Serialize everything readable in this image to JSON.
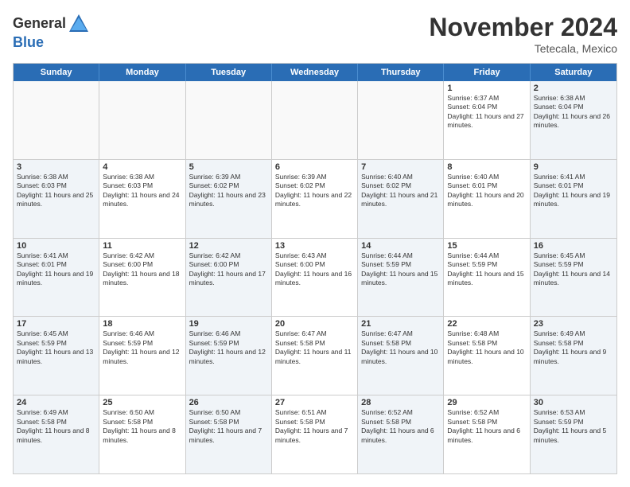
{
  "logo": {
    "line1": "General",
    "line2": "Blue"
  },
  "title": "November 2024",
  "subtitle": "Tetecala, Mexico",
  "header_days": [
    "Sunday",
    "Monday",
    "Tuesday",
    "Wednesday",
    "Thursday",
    "Friday",
    "Saturday"
  ],
  "weeks": [
    [
      {
        "day": "",
        "info": "",
        "empty": true
      },
      {
        "day": "",
        "info": "",
        "empty": true
      },
      {
        "day": "",
        "info": "",
        "empty": true
      },
      {
        "day": "",
        "info": "",
        "empty": true
      },
      {
        "day": "",
        "info": "",
        "empty": true
      },
      {
        "day": "1",
        "info": "Sunrise: 6:37 AM\nSunset: 6:04 PM\nDaylight: 11 hours and 27 minutes.",
        "empty": false
      },
      {
        "day": "2",
        "info": "Sunrise: 6:38 AM\nSunset: 6:04 PM\nDaylight: 11 hours and 26 minutes.",
        "empty": false
      }
    ],
    [
      {
        "day": "3",
        "info": "Sunrise: 6:38 AM\nSunset: 6:03 PM\nDaylight: 11 hours and 25 minutes.",
        "empty": false
      },
      {
        "day": "4",
        "info": "Sunrise: 6:38 AM\nSunset: 6:03 PM\nDaylight: 11 hours and 24 minutes.",
        "empty": false
      },
      {
        "day": "5",
        "info": "Sunrise: 6:39 AM\nSunset: 6:02 PM\nDaylight: 11 hours and 23 minutes.",
        "empty": false
      },
      {
        "day": "6",
        "info": "Sunrise: 6:39 AM\nSunset: 6:02 PM\nDaylight: 11 hours and 22 minutes.",
        "empty": false
      },
      {
        "day": "7",
        "info": "Sunrise: 6:40 AM\nSunset: 6:02 PM\nDaylight: 11 hours and 21 minutes.",
        "empty": false
      },
      {
        "day": "8",
        "info": "Sunrise: 6:40 AM\nSunset: 6:01 PM\nDaylight: 11 hours and 20 minutes.",
        "empty": false
      },
      {
        "day": "9",
        "info": "Sunrise: 6:41 AM\nSunset: 6:01 PM\nDaylight: 11 hours and 19 minutes.",
        "empty": false
      }
    ],
    [
      {
        "day": "10",
        "info": "Sunrise: 6:41 AM\nSunset: 6:01 PM\nDaylight: 11 hours and 19 minutes.",
        "empty": false
      },
      {
        "day": "11",
        "info": "Sunrise: 6:42 AM\nSunset: 6:00 PM\nDaylight: 11 hours and 18 minutes.",
        "empty": false
      },
      {
        "day": "12",
        "info": "Sunrise: 6:42 AM\nSunset: 6:00 PM\nDaylight: 11 hours and 17 minutes.",
        "empty": false
      },
      {
        "day": "13",
        "info": "Sunrise: 6:43 AM\nSunset: 6:00 PM\nDaylight: 11 hours and 16 minutes.",
        "empty": false
      },
      {
        "day": "14",
        "info": "Sunrise: 6:44 AM\nSunset: 5:59 PM\nDaylight: 11 hours and 15 minutes.",
        "empty": false
      },
      {
        "day": "15",
        "info": "Sunrise: 6:44 AM\nSunset: 5:59 PM\nDaylight: 11 hours and 15 minutes.",
        "empty": false
      },
      {
        "day": "16",
        "info": "Sunrise: 6:45 AM\nSunset: 5:59 PM\nDaylight: 11 hours and 14 minutes.",
        "empty": false
      }
    ],
    [
      {
        "day": "17",
        "info": "Sunrise: 6:45 AM\nSunset: 5:59 PM\nDaylight: 11 hours and 13 minutes.",
        "empty": false
      },
      {
        "day": "18",
        "info": "Sunrise: 6:46 AM\nSunset: 5:59 PM\nDaylight: 11 hours and 12 minutes.",
        "empty": false
      },
      {
        "day": "19",
        "info": "Sunrise: 6:46 AM\nSunset: 5:59 PM\nDaylight: 11 hours and 12 minutes.",
        "empty": false
      },
      {
        "day": "20",
        "info": "Sunrise: 6:47 AM\nSunset: 5:58 PM\nDaylight: 11 hours and 11 minutes.",
        "empty": false
      },
      {
        "day": "21",
        "info": "Sunrise: 6:47 AM\nSunset: 5:58 PM\nDaylight: 11 hours and 10 minutes.",
        "empty": false
      },
      {
        "day": "22",
        "info": "Sunrise: 6:48 AM\nSunset: 5:58 PM\nDaylight: 11 hours and 10 minutes.",
        "empty": false
      },
      {
        "day": "23",
        "info": "Sunrise: 6:49 AM\nSunset: 5:58 PM\nDaylight: 11 hours and 9 minutes.",
        "empty": false
      }
    ],
    [
      {
        "day": "24",
        "info": "Sunrise: 6:49 AM\nSunset: 5:58 PM\nDaylight: 11 hours and 8 minutes.",
        "empty": false
      },
      {
        "day": "25",
        "info": "Sunrise: 6:50 AM\nSunset: 5:58 PM\nDaylight: 11 hours and 8 minutes.",
        "empty": false
      },
      {
        "day": "26",
        "info": "Sunrise: 6:50 AM\nSunset: 5:58 PM\nDaylight: 11 hours and 7 minutes.",
        "empty": false
      },
      {
        "day": "27",
        "info": "Sunrise: 6:51 AM\nSunset: 5:58 PM\nDaylight: 11 hours and 7 minutes.",
        "empty": false
      },
      {
        "day": "28",
        "info": "Sunrise: 6:52 AM\nSunset: 5:58 PM\nDaylight: 11 hours and 6 minutes.",
        "empty": false
      },
      {
        "day": "29",
        "info": "Sunrise: 6:52 AM\nSunset: 5:58 PM\nDaylight: 11 hours and 6 minutes.",
        "empty": false
      },
      {
        "day": "30",
        "info": "Sunrise: 6:53 AM\nSunset: 5:59 PM\nDaylight: 11 hours and 5 minutes.",
        "empty": false
      }
    ]
  ]
}
